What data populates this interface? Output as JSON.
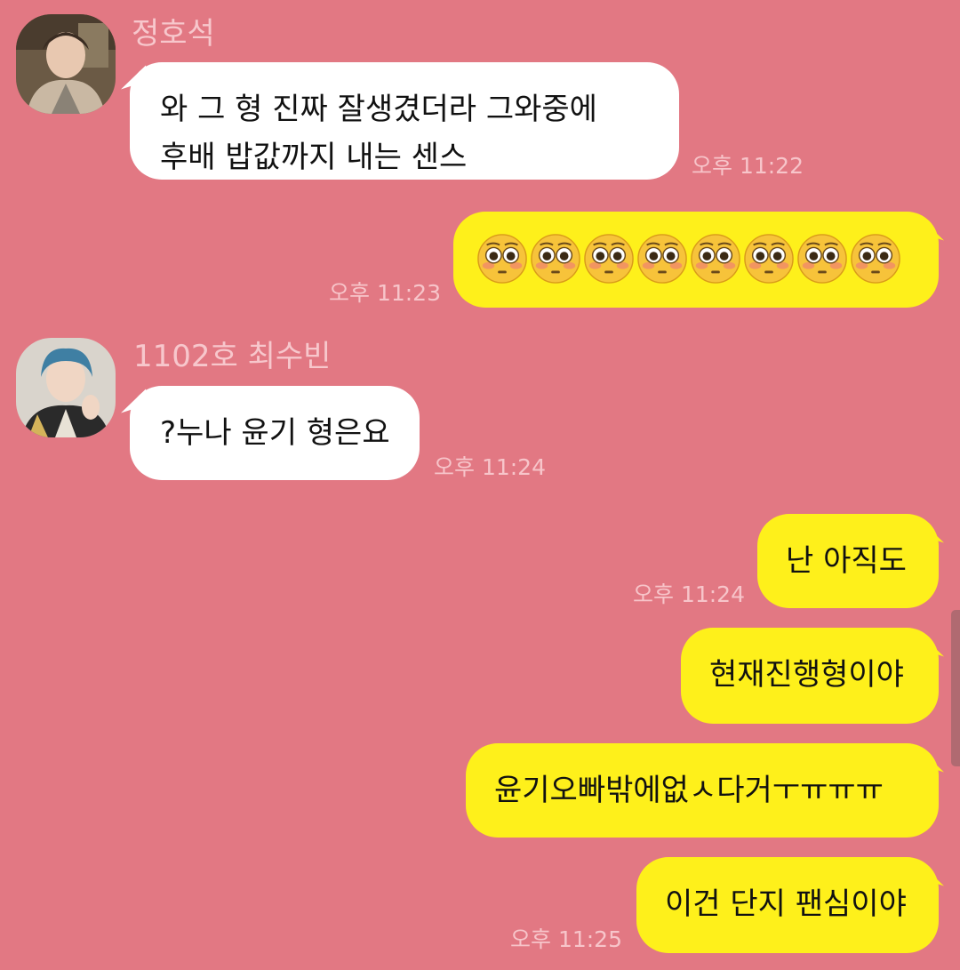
{
  "messages": [
    {
      "sender": "정호석",
      "lines": [
        "와 그 형 진짜 잘생겼더라 그와중에",
        "후배 밥값까지 내는 센스"
      ],
      "time": "오후 11:22"
    },
    {
      "emoji_name": "flushed-face-icon",
      "emoji_count": 8,
      "time": "오후 11:23"
    },
    {
      "sender": "1102호 최수빈",
      "lines": [
        "?누나 윤기 형은요"
      ],
      "time": "오후 11:24"
    },
    {
      "lines": [
        "난 아직도"
      ],
      "time": "오후 11:24"
    },
    {
      "lines": [
        "현재진행형이야"
      ]
    },
    {
      "lines": [
        "윤기오빠밖에없ㅅ다거ㅜㅠㅠㅠ"
      ]
    },
    {
      "lines": [
        "이건 단지 팬심이야"
      ],
      "time": "오후 11:25"
    }
  ],
  "colors": {
    "background": "#e27883",
    "incoming_bubble": "#ffffff",
    "outgoing_bubble": "#fef01b",
    "name_text": "#f7c7cc",
    "time_text": "#f7c5ca"
  }
}
